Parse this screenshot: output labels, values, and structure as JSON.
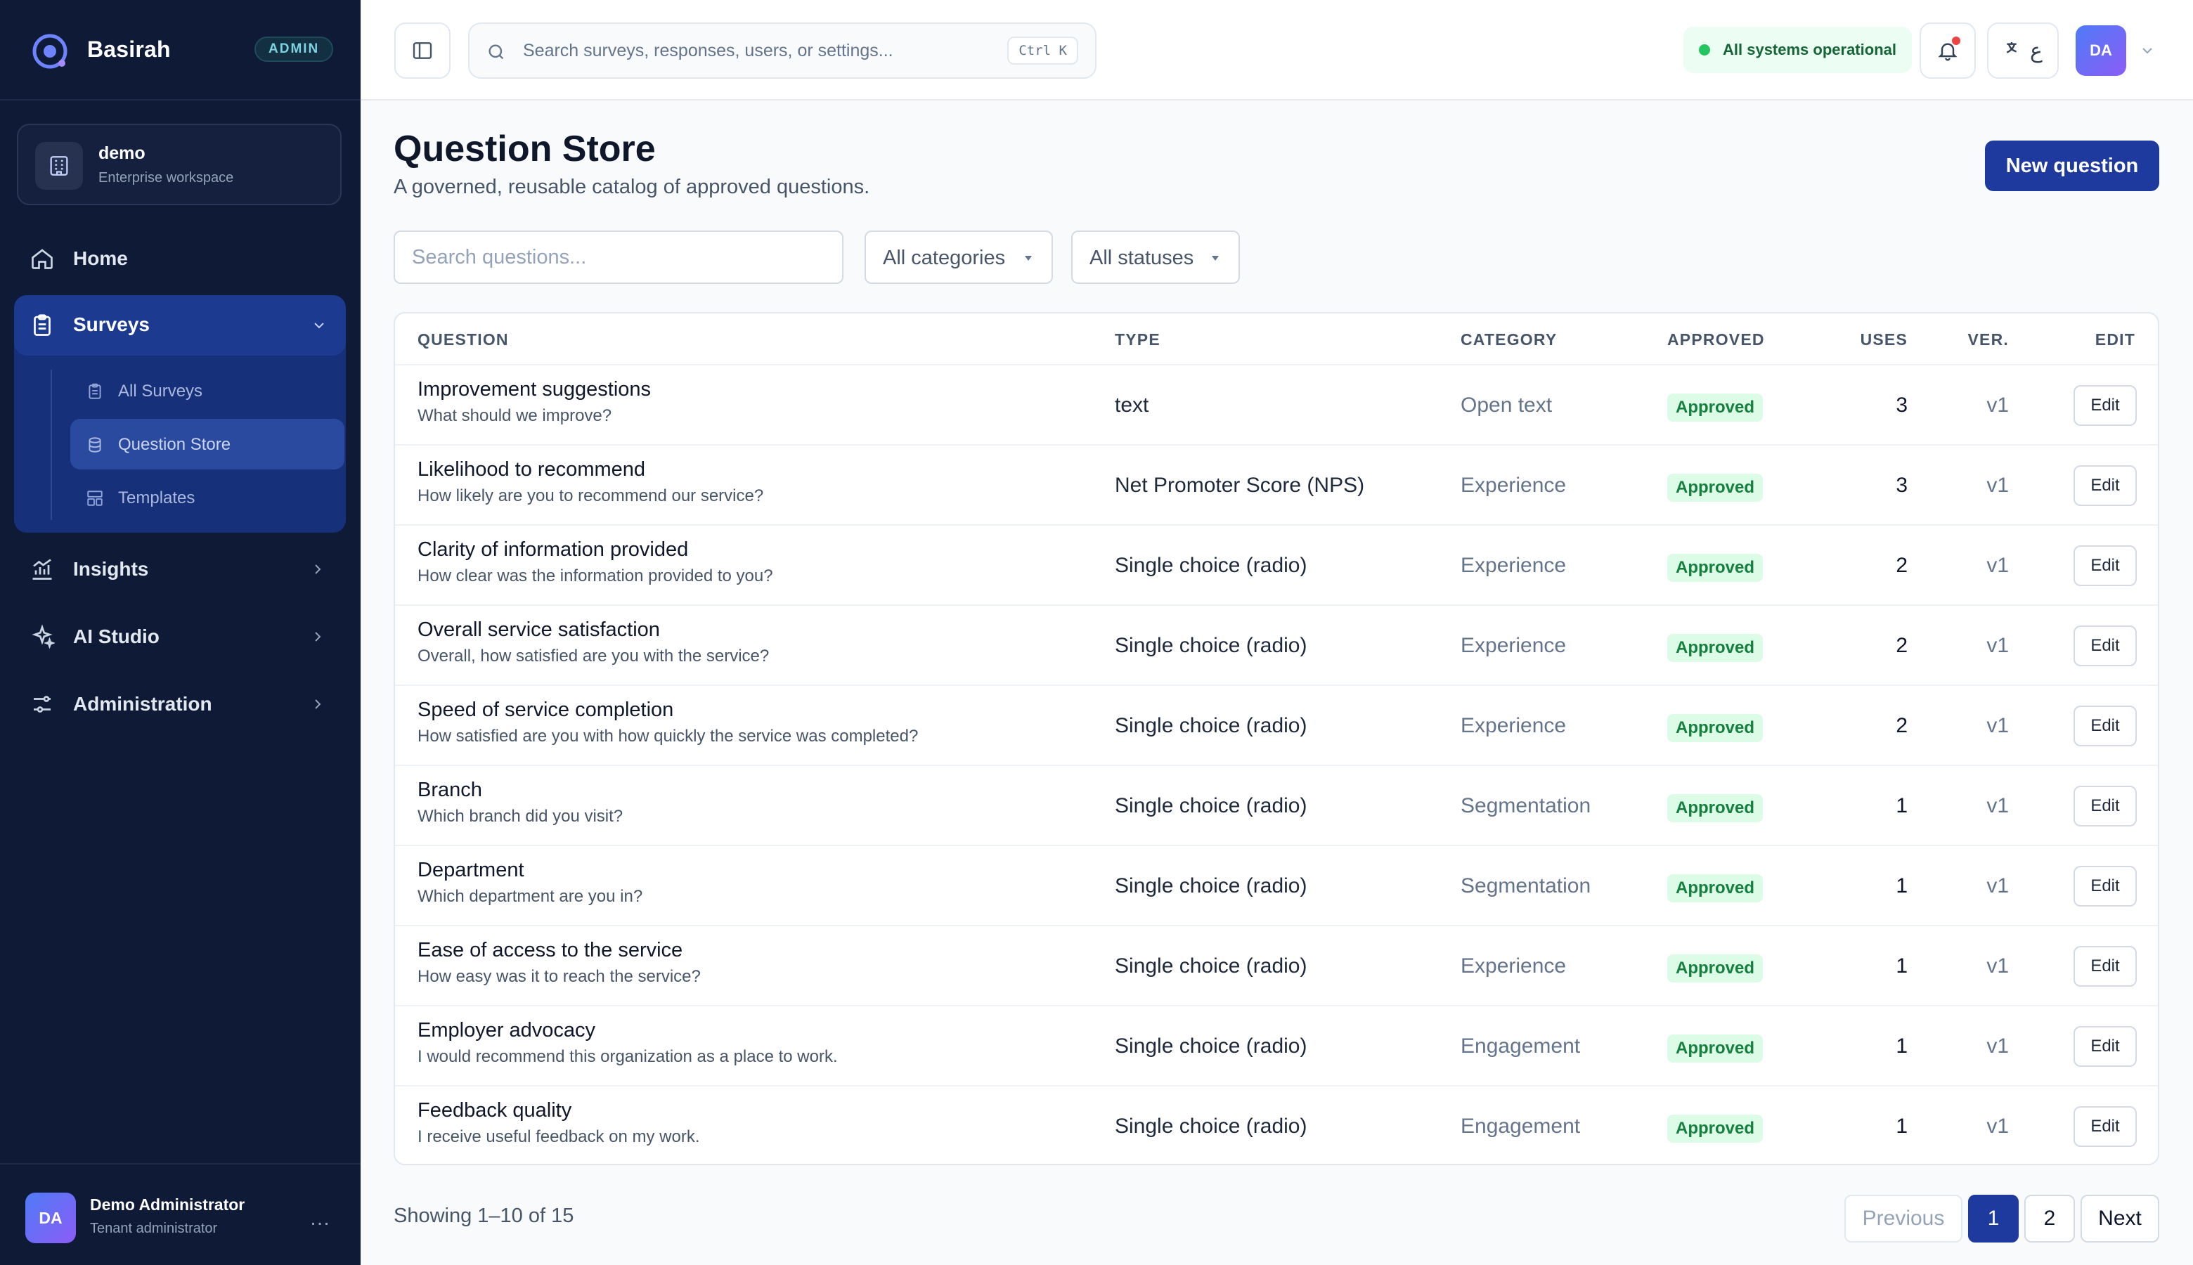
{
  "app": {
    "brand": "Basirah",
    "role_badge": "ADMIN"
  },
  "workspace": {
    "name": "demo",
    "subtitle": "Enterprise workspace"
  },
  "sidebar": {
    "home": "Home",
    "surveys": "Surveys",
    "survey_items": [
      "All Surveys",
      "Question Store",
      "Templates"
    ],
    "insights": "Insights",
    "ai_studio": "AI Studio",
    "administration": "Administration"
  },
  "user": {
    "initials": "DA",
    "name": "Demo Administrator",
    "role": "Tenant administrator",
    "more": "…"
  },
  "topbar": {
    "search_placeholder": "Search surveys, responses, users, or settings...",
    "shortcut": "Ctrl K",
    "status": "All systems operational",
    "lang_glyph": "ع"
  },
  "page": {
    "title": "Question Store",
    "subtitle": "A governed, reusable catalog of approved questions.",
    "new_button": "New question",
    "search_placeholder": "Search questions...",
    "category_filter": "All categories",
    "status_filter": "All statuses"
  },
  "table": {
    "headers": {
      "question": "QUESTION",
      "type": "TYPE",
      "category": "CATEGORY",
      "approved": "APPROVED",
      "uses": "USES",
      "ver": "VER.",
      "edit": "EDIT"
    },
    "edit_label": "Edit",
    "rows": [
      {
        "title": "Improvement suggestions",
        "text": "What should we improve?",
        "type": "text",
        "category": "Open text",
        "status": "Approved",
        "uses": "3",
        "version": "v1"
      },
      {
        "title": "Likelihood to recommend",
        "text": "How likely are you to recommend our service?",
        "type": "Net Promoter Score (NPS)",
        "category": "Experience",
        "status": "Approved",
        "uses": "3",
        "version": "v1"
      },
      {
        "title": "Clarity of information provided",
        "text": "How clear was the information provided to you?",
        "type": "Single choice (radio)",
        "category": "Experience",
        "status": "Approved",
        "uses": "2",
        "version": "v1"
      },
      {
        "title": "Overall service satisfaction",
        "text": "Overall, how satisfied are you with the service?",
        "type": "Single choice (radio)",
        "category": "Experience",
        "status": "Approved",
        "uses": "2",
        "version": "v1"
      },
      {
        "title": "Speed of service completion",
        "text": "How satisfied are you with how quickly the service was completed?",
        "type": "Single choice (radio)",
        "category": "Experience",
        "status": "Approved",
        "uses": "2",
        "version": "v1"
      },
      {
        "title": "Branch",
        "text": "Which branch did you visit?",
        "type": "Single choice (radio)",
        "category": "Segmentation",
        "status": "Approved",
        "uses": "1",
        "version": "v1"
      },
      {
        "title": "Department",
        "text": "Which department are you in?",
        "type": "Single choice (radio)",
        "category": "Segmentation",
        "status": "Approved",
        "uses": "1",
        "version": "v1"
      },
      {
        "title": "Ease of access to the service",
        "text": "How easy was it to reach the service?",
        "type": "Single choice (radio)",
        "category": "Experience",
        "status": "Approved",
        "uses": "1",
        "version": "v1"
      },
      {
        "title": "Employer advocacy",
        "text": "I would recommend this organization as a place to work.",
        "type": "Single choice (radio)",
        "category": "Engagement",
        "status": "Approved",
        "uses": "1",
        "version": "v1"
      },
      {
        "title": "Feedback quality",
        "text": "I receive useful feedback on my work.",
        "type": "Single choice (radio)",
        "category": "Engagement",
        "status": "Approved",
        "uses": "1",
        "version": "v1"
      }
    ]
  },
  "pagination": {
    "showing": "Showing 1–10 of 15",
    "previous": "Previous",
    "pages": [
      "1",
      "2"
    ],
    "current": "1",
    "next": "Next"
  },
  "colors": {
    "sidebar_bg": "#0f1a36",
    "accent": "#1e3a9e",
    "approved_bg": "#dcfce7",
    "approved_text": "#15803d",
    "status_ok": "#22c55e",
    "notification": "#ef4444"
  }
}
